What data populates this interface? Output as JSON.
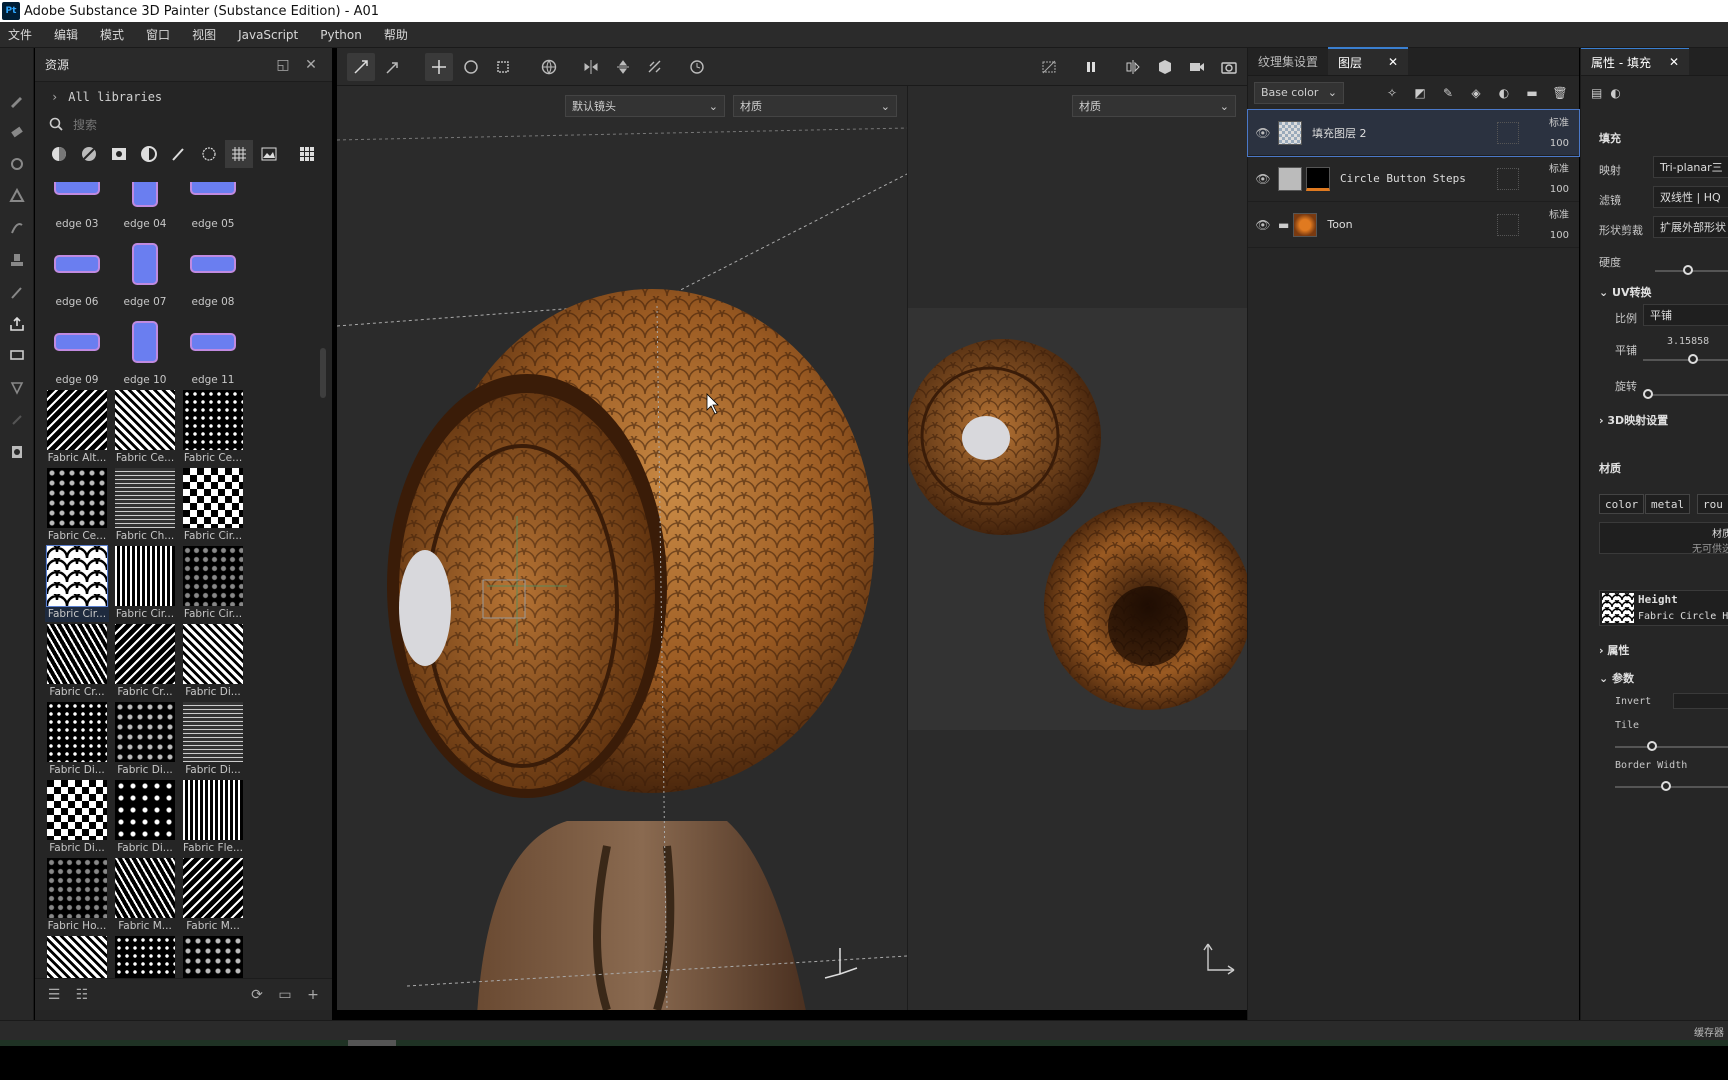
{
  "window": {
    "title": "Adobe Substance 3D Painter (Substance Edition) - A01",
    "app_icon": "Pt"
  },
  "menu": [
    "文件",
    "编辑",
    "模式",
    "窗口",
    "视图",
    "JavaScript",
    "Python",
    "帮助"
  ],
  "assets": {
    "title": "资源",
    "libraries": "All libraries",
    "search_placeholder": "搜索",
    "items": [
      {
        "label": "edge 03",
        "kind": "edge"
      },
      {
        "label": "edge 04",
        "kind": "edge"
      },
      {
        "label": "edge 05",
        "kind": "edge"
      },
      {
        "label": "edge 06",
        "kind": "edge"
      },
      {
        "label": "edge 07",
        "kind": "edge"
      },
      {
        "label": "edge 08",
        "kind": "edge"
      },
      {
        "label": "edge 09",
        "kind": "edge"
      },
      {
        "label": "edge 10",
        "kind": "edge"
      },
      {
        "label": "edge 11",
        "kind": "edge"
      },
      {
        "label": "Fabric Alt...",
        "kind": "pattern"
      },
      {
        "label": "Fabric Ce...",
        "kind": "pattern"
      },
      {
        "label": "Fabric Ce...",
        "kind": "pattern"
      },
      {
        "label": "Fabric Ce...",
        "kind": "pattern"
      },
      {
        "label": "Fabric Ch...",
        "kind": "pattern"
      },
      {
        "label": "Fabric Cir...",
        "kind": "pattern"
      },
      {
        "label": "Fabric Cir...",
        "kind": "scales",
        "selected": true
      },
      {
        "label": "Fabric Cir...",
        "kind": "pattern"
      },
      {
        "label": "Fabric Cir...",
        "kind": "pattern"
      },
      {
        "label": "Fabric Cr...",
        "kind": "pattern"
      },
      {
        "label": "Fabric Cr...",
        "kind": "pattern"
      },
      {
        "label": "Fabric Di...",
        "kind": "pattern"
      },
      {
        "label": "Fabric Di...",
        "kind": "pattern"
      },
      {
        "label": "Fabric Di...",
        "kind": "pattern"
      },
      {
        "label": "Fabric Di...",
        "kind": "pattern"
      },
      {
        "label": "Fabric Di...",
        "kind": "pattern"
      },
      {
        "label": "Fabric Di...",
        "kind": "pattern"
      },
      {
        "label": "Fabric Fle...",
        "kind": "pattern"
      },
      {
        "label": "Fabric Ho...",
        "kind": "pattern"
      },
      {
        "label": "Fabric M...",
        "kind": "pattern"
      },
      {
        "label": "Fabric M...",
        "kind": "pattern"
      },
      {
        "label": "",
        "kind": "pattern"
      },
      {
        "label": "",
        "kind": "pattern"
      },
      {
        "label": "",
        "kind": "pattern"
      }
    ]
  },
  "viewport": {
    "camera": "默认镜头",
    "mode3d": "材质",
    "mode2d": "材质"
  },
  "layers": {
    "tab_texture_set": "纹理集设置",
    "tab_layers": "图层",
    "channel": "Base color",
    "items": [
      {
        "name": "填充图层 2",
        "blend": "标准",
        "opacity": "100",
        "selected": true
      },
      {
        "name": "Circle Button Steps",
        "blend": "标准",
        "opacity": "100"
      },
      {
        "name": "Toon",
        "blend": "标准",
        "opacity": "100"
      }
    ]
  },
  "properties": {
    "tab": "属性 - 填充",
    "fill": "填充",
    "mapping_label": "映射",
    "mapping_value": "Tri-planar三",
    "filter_label": "滤镜",
    "filter_value": "双线性 | HQ",
    "shape_label": "形状剪裁",
    "shape_value": "扩展外部形状",
    "hardness_label": "硬度",
    "uv_section": "UV转换",
    "scale_label": "比例",
    "scale_value": "平铺",
    "tile_label": "平铺",
    "tile_value": "3.15858",
    "rotate_label": "旋转",
    "proj3d": "3D映射设置",
    "material": "材质",
    "chips": [
      "color",
      "metal",
      "rou"
    ],
    "material_note1": "材质",
    "material_note2": "无可供选",
    "height_label": "Height",
    "height_resource": "Fabric Circle H",
    "attr": "属性",
    "params": "参数",
    "invert": "Invert",
    "tile": "Tile",
    "border": "Border Width"
  },
  "status": {
    "right": "缓存器"
  }
}
